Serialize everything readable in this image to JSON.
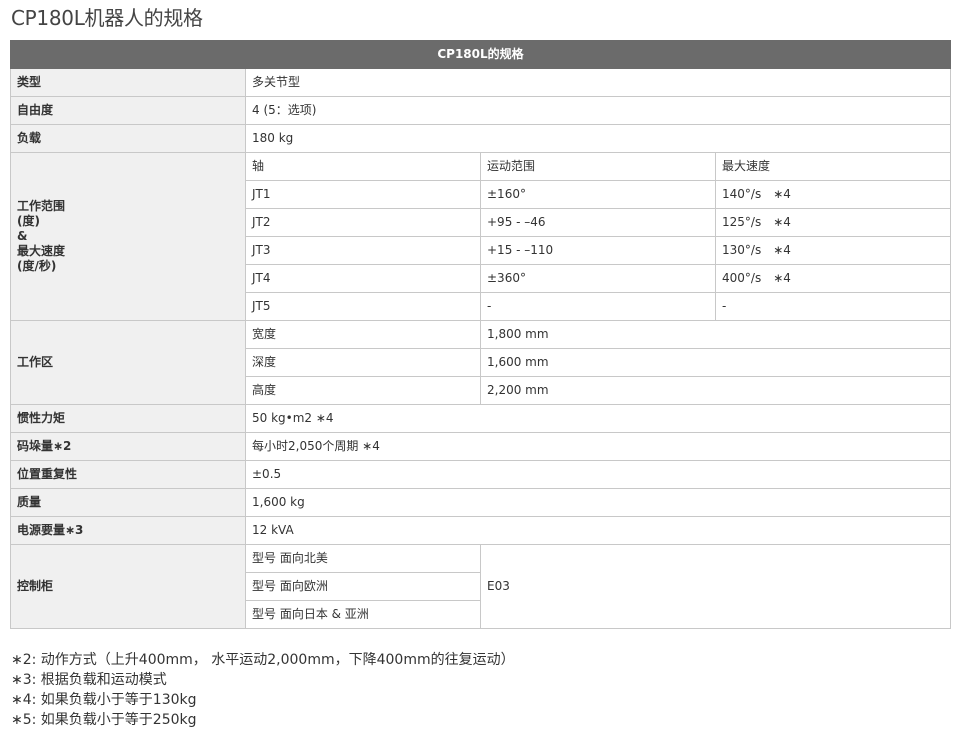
{
  "page_title": "CP180L机器人的规格",
  "table_header": "CP180L的规格",
  "rows": {
    "type": {
      "label": "类型",
      "value": "多关节型"
    },
    "dof": {
      "label": "自由度",
      "value": "4 (5：选项)"
    },
    "payload": {
      "label": "负载",
      "value": "180 kg"
    },
    "range": {
      "label_lines": [
        "工作范围",
        "(度)",
        "&",
        "最大速度",
        "(度/秒)"
      ],
      "col_headers": [
        "轴",
        "运动范围",
        "最大速度"
      ],
      "axes": [
        {
          "axis": "JT1",
          "range": "±160°",
          "speed": "140°/s　∗4"
        },
        {
          "axis": "JT2",
          "range": "+95 - –46",
          "speed": "125°/s　∗4"
        },
        {
          "axis": "JT3",
          "range": "+15 - –110",
          "speed": "130°/s　∗4"
        },
        {
          "axis": "JT4",
          "range": "±360°",
          "speed": "400°/s　∗4"
        },
        {
          "axis": "JT5",
          "range": "-",
          "speed": "-"
        }
      ]
    },
    "workarea": {
      "label": "工作区",
      "items": [
        {
          "name": "宽度",
          "value": "1,800 mm"
        },
        {
          "name": "深度",
          "value": "1,600 mm"
        },
        {
          "name": "高度",
          "value": "2,200 mm"
        }
      ]
    },
    "inertia": {
      "label": "惯性力矩",
      "value": "50 kg•m2 ∗4"
    },
    "stacking": {
      "label": "码垛量∗2",
      "value": "每小时2,050个周期 ∗4"
    },
    "repeatability": {
      "label": "位置重复性",
      "value": "±0.5"
    },
    "mass": {
      "label": "质量",
      "value": "1,600 kg"
    },
    "power": {
      "label": "电源要量∗3",
      "value": "12 kVA"
    },
    "controller": {
      "label": "控制柜",
      "models": [
        "型号 面向北美",
        "型号 面向欧洲",
        "型号 面向日本 & 亚洲"
      ],
      "value": "E03"
    }
  },
  "notes": [
    "∗2: 动作方式（上升400mm， 水平运动2,000mm，下降400mm的往复运动）",
    "∗3: 根据负载和运动模式",
    "∗4: 如果负载小于等于130kg",
    "∗5: 如果负载小于等于250kg"
  ]
}
